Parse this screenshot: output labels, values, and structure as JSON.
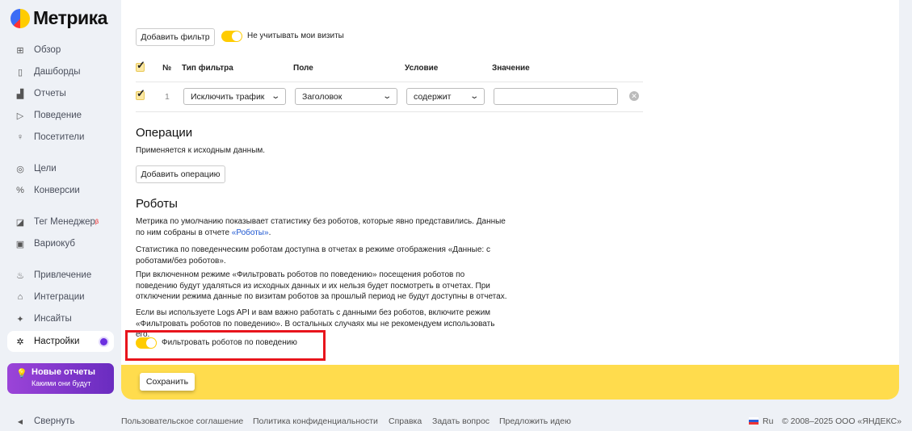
{
  "app": {
    "logo_text": "Метрика"
  },
  "sidebar": {
    "items": [
      {
        "label": "Обзор",
        "icon": "grid-icon"
      },
      {
        "label": "Дашборды",
        "icon": "dashboards-icon"
      },
      {
        "label": "Отчеты",
        "icon": "bar-chart-icon"
      },
      {
        "label": "Поведение",
        "icon": "play-icon"
      },
      {
        "label": "Посетители",
        "icon": "user-icon"
      },
      {
        "label": "Цели",
        "icon": "target-icon"
      },
      {
        "label": "Конверсии",
        "icon": "percent-icon"
      },
      {
        "label": "Тег Менеджер",
        "icon": "tag-manager-icon",
        "badge": "β"
      },
      {
        "label": "Вариокуб",
        "icon": "variocube-icon"
      },
      {
        "label": "Привлечение",
        "icon": "fire-icon"
      },
      {
        "label": "Интеграции",
        "icon": "puzzle-icon"
      },
      {
        "label": "Инсайты",
        "icon": "sparkle-icon"
      },
      {
        "label": "Настройки",
        "icon": "gear-icon"
      }
    ],
    "promo": {
      "title": "Новые отчеты",
      "subtitle": "Какими они будут"
    },
    "collapse": "Свернуть"
  },
  "filters": {
    "add_filter": "Добавить фильтр",
    "ignore_visits": "Не учитывать мои визиты",
    "ignore_visits_on": true,
    "headers": {
      "num": "№",
      "type": "Тип фильтра",
      "field": "Поле",
      "condition": "Условие",
      "value": "Значение"
    },
    "rows": [
      {
        "checked": true,
        "num": "1",
        "type": "Исключить трафик",
        "field": "Заголовок",
        "condition": "содержит",
        "value": ""
      }
    ]
  },
  "operations": {
    "title": "Операции",
    "desc": "Применяется к исходным данным.",
    "add": "Добавить операцию"
  },
  "robots": {
    "title": "Роботы",
    "p1": "Метрика по умолчанию показывает статистику без роботов, которые явно представились. Данные по ним собраны в отчете ",
    "p1_link": "«Роботы»",
    "p1_end": ".",
    "p2": "Статистика по поведенческим роботам доступна в отчетах в режиме отображения «Данные: с роботами/без роботов».",
    "p3": "При включенном режиме «Фильтровать роботов по поведению» посещения роботов по поведению будут удаляться из исходных данных и их нельзя будет посмотреть в отчетах. При отключении режима данные по визитам роботов за прошлый период не будут доступны в отчетах.",
    "p4": "Если вы используете Logs API и вам важно работать с данными без роботов, включите режим «Фильтровать роботов по поведению». В остальных случаях мы не рекомендуем использовать его.",
    "toggle_label": "Фильтровать роботов по поведению",
    "toggle_on": true
  },
  "save": "Сохранить",
  "footer": {
    "links": [
      "Пользовательское соглашение",
      "Политика конфиденциальности",
      "Справка",
      "Задать вопрос",
      "Предложить идею"
    ],
    "lang": "Ru",
    "copyright": "© 2008–2025 ООО «ЯНДЕКС»"
  },
  "colors": {
    "accent": "#ffcc00",
    "highlight": "#e8141c",
    "promo": "#7a35c8"
  }
}
